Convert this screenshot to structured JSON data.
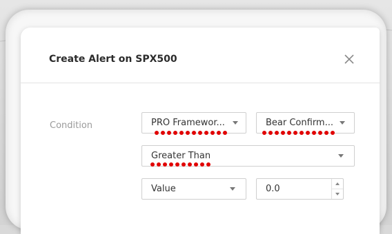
{
  "dialog": {
    "title": "Create Alert on SPX500",
    "close_icon": "close-icon"
  },
  "condition": {
    "label": "Condition",
    "indicator_select": "PRO Framewor...",
    "plot_select": "Bear Confirm...",
    "operator_select": "Greater Than",
    "value_type_select": "Value",
    "value_input": "0.0"
  },
  "colors": {
    "redaction_dots": "#e10000",
    "label_gray": "#9a9a9a"
  }
}
